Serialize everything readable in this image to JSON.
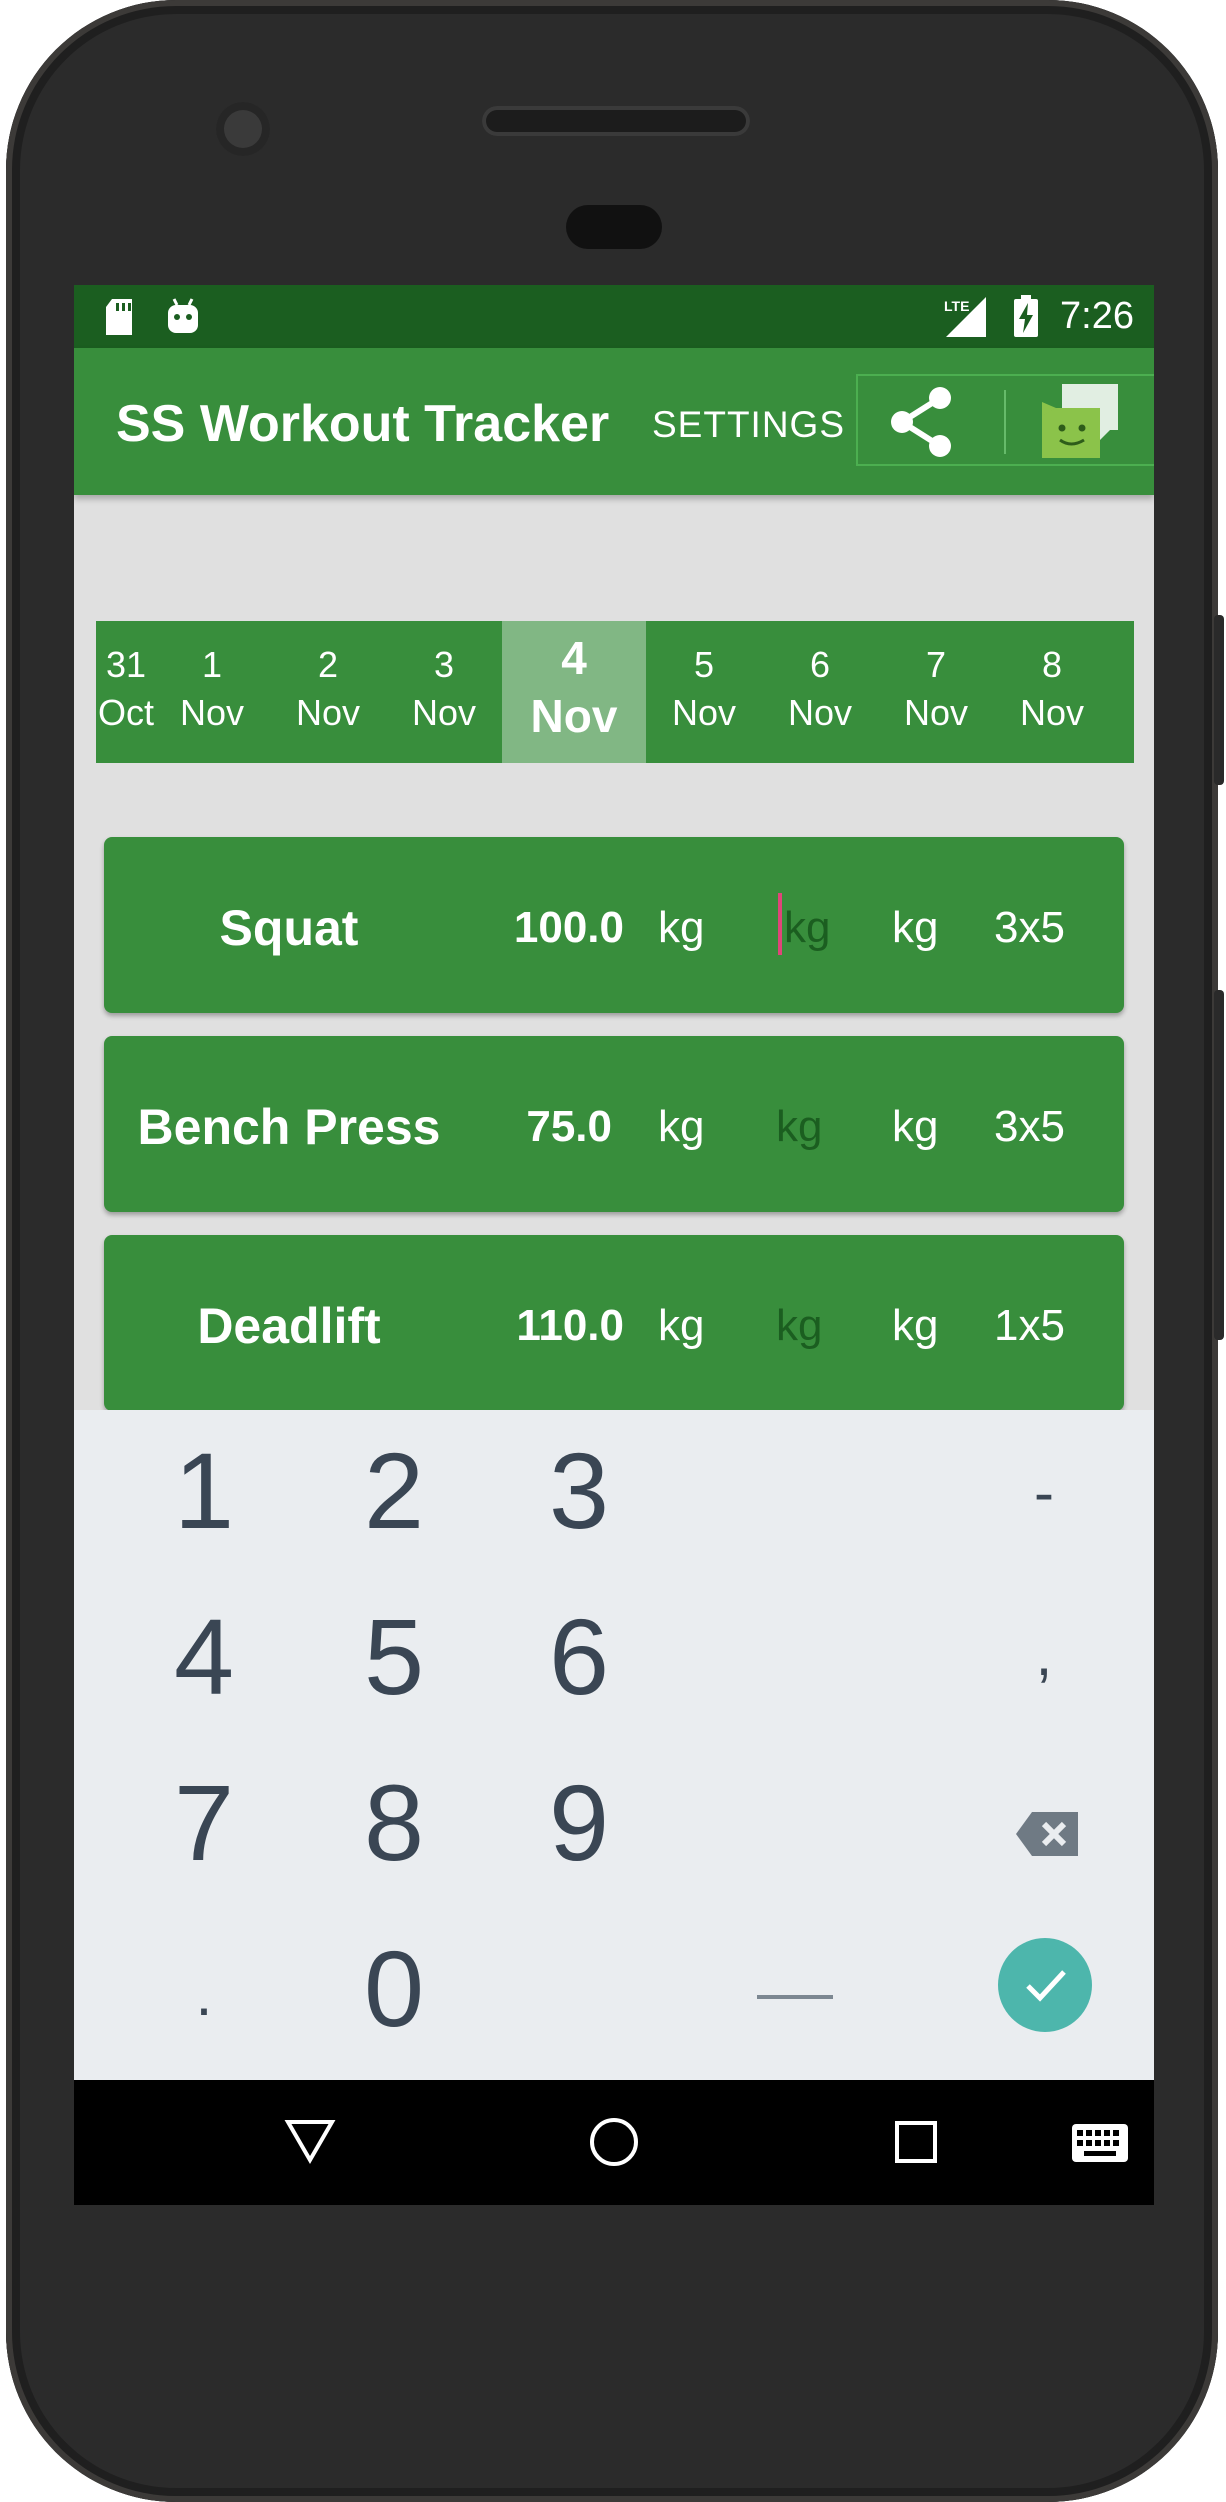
{
  "status": {
    "time": "7:26",
    "network": "LTE"
  },
  "appbar": {
    "title": "SS Workout Tracker",
    "settings": "SETTINGS"
  },
  "dates": [
    {
      "day": "31",
      "month": "Oct"
    },
    {
      "day": "1",
      "month": "Nov"
    },
    {
      "day": "2",
      "month": "Nov"
    },
    {
      "day": "3",
      "month": "Nov"
    },
    {
      "day": "4",
      "month": "Nov",
      "selected": true
    },
    {
      "day": "5",
      "month": "Nov"
    },
    {
      "day": "6",
      "month": "Nov"
    },
    {
      "day": "7",
      "month": "Nov"
    },
    {
      "day": "8",
      "month": "Nov"
    }
  ],
  "exercises": [
    {
      "name": "Squat",
      "weight": "100.0",
      "unit1": "kg",
      "unit2": "kg",
      "unit3": "kg",
      "sets": "3x5"
    },
    {
      "name": "Bench Press",
      "weight": "75.0",
      "unit1": "kg",
      "unit2": "kg",
      "unit3": "kg",
      "sets": "3x5"
    },
    {
      "name": "Deadlift",
      "weight": "110.0",
      "unit1": "kg",
      "unit2": "kg",
      "unit3": "kg",
      "sets": "1x5"
    }
  ],
  "keypad": {
    "k1": "1",
    "k2": "2",
    "k3": "3",
    "minus": "-",
    "k4": "4",
    "k5": "5",
    "k6": "6",
    "comma": ",",
    "k7": "7",
    "k8": "8",
    "k9": "9",
    "dot": ".",
    "k0": "0",
    "space": "___"
  },
  "icons": {
    "share": "share-icon",
    "chat": "chat-icon",
    "backspace": "backspace-icon",
    "confirm": "check-icon",
    "back": "back-icon",
    "home": "home-icon",
    "recents": "recents-icon",
    "keyboard": "keyboard-icon"
  },
  "colors": {
    "statusbar": "#1b5e20",
    "appbar": "#388e3c",
    "selected_date": "#81b784",
    "confirm": "#4db6ac",
    "cursor": "#e0457a"
  }
}
